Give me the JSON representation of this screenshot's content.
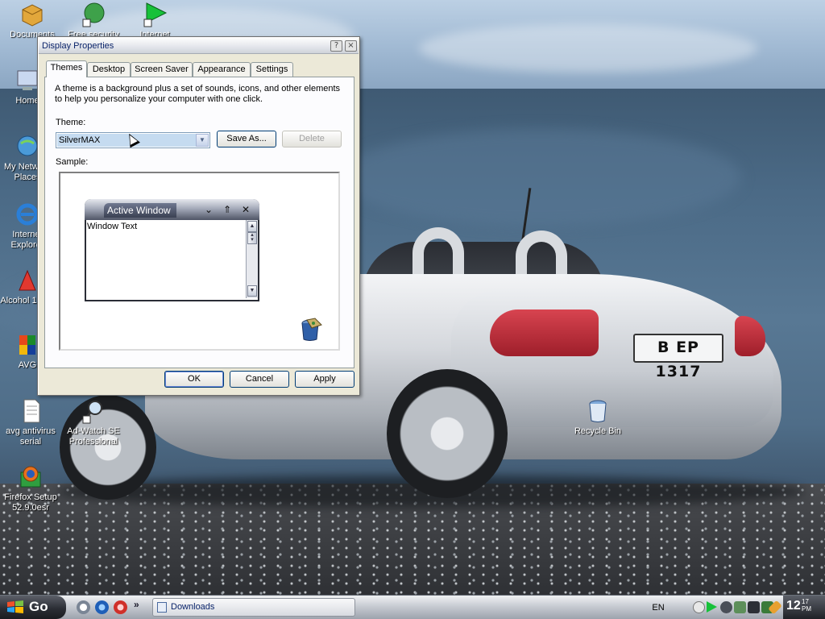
{
  "desktop": {
    "icons": [
      {
        "label": "Documents",
        "icon": "folder-icon"
      },
      {
        "label": "Free security",
        "icon": "globe-shortcut-icon"
      },
      {
        "label": "Internet",
        "icon": "green-arrow-shortcut-icon"
      },
      {
        "label": "Home",
        "icon": "computer-icon"
      },
      {
        "label": "My Network Places",
        "icon": "network-places-icon"
      },
      {
        "label": "Internet Explorer",
        "icon": "internet-explorer-icon"
      },
      {
        "label": "Alcohol 120%",
        "icon": "alcohol-icon"
      },
      {
        "label": "AVG",
        "icon": "avg-icon"
      },
      {
        "label": "avg antivirus serial",
        "icon": "text-document-icon"
      },
      {
        "label": "Ad-Watch SE Professional",
        "icon": "magnifier-shortcut-icon"
      },
      {
        "label": "Firefox Setup 52.9.0esr",
        "icon": "firefox-setup-icon"
      },
      {
        "label": "Recycle Bin",
        "icon": "recycle-bin-icon"
      }
    ],
    "wallpaper_plate": "B EP 1317"
  },
  "dialog": {
    "title": "Display Properties",
    "help_button": "?",
    "close_button": "×",
    "tabs": [
      "Themes",
      "Desktop",
      "Screen Saver",
      "Appearance",
      "Settings"
    ],
    "active_tab": "Themes",
    "description": "A theme is a background plus a set of sounds, icons, and other elements to help you personalize your computer with one click.",
    "theme_label": "Theme:",
    "theme_value": "SilverMAX",
    "save_as_button": "Save As...",
    "delete_button": "Delete",
    "sample_label": "Sample:",
    "sample_window": {
      "title": "Active Window",
      "text": "Window Text"
    },
    "ok_button": "OK",
    "cancel_button": "Cancel",
    "apply_button": "Apply"
  },
  "taskbar": {
    "start_label": "Go",
    "quick_launch_overflow": "»",
    "task_button": "Downloads",
    "language": "EN",
    "clock_hour": "12",
    "clock_minute": "17",
    "clock_ampm": "PM"
  },
  "colors": {
    "accent_selection": "#c5dbf0",
    "dialog_background": "#ece9d8",
    "title_text": "#0a246a"
  }
}
